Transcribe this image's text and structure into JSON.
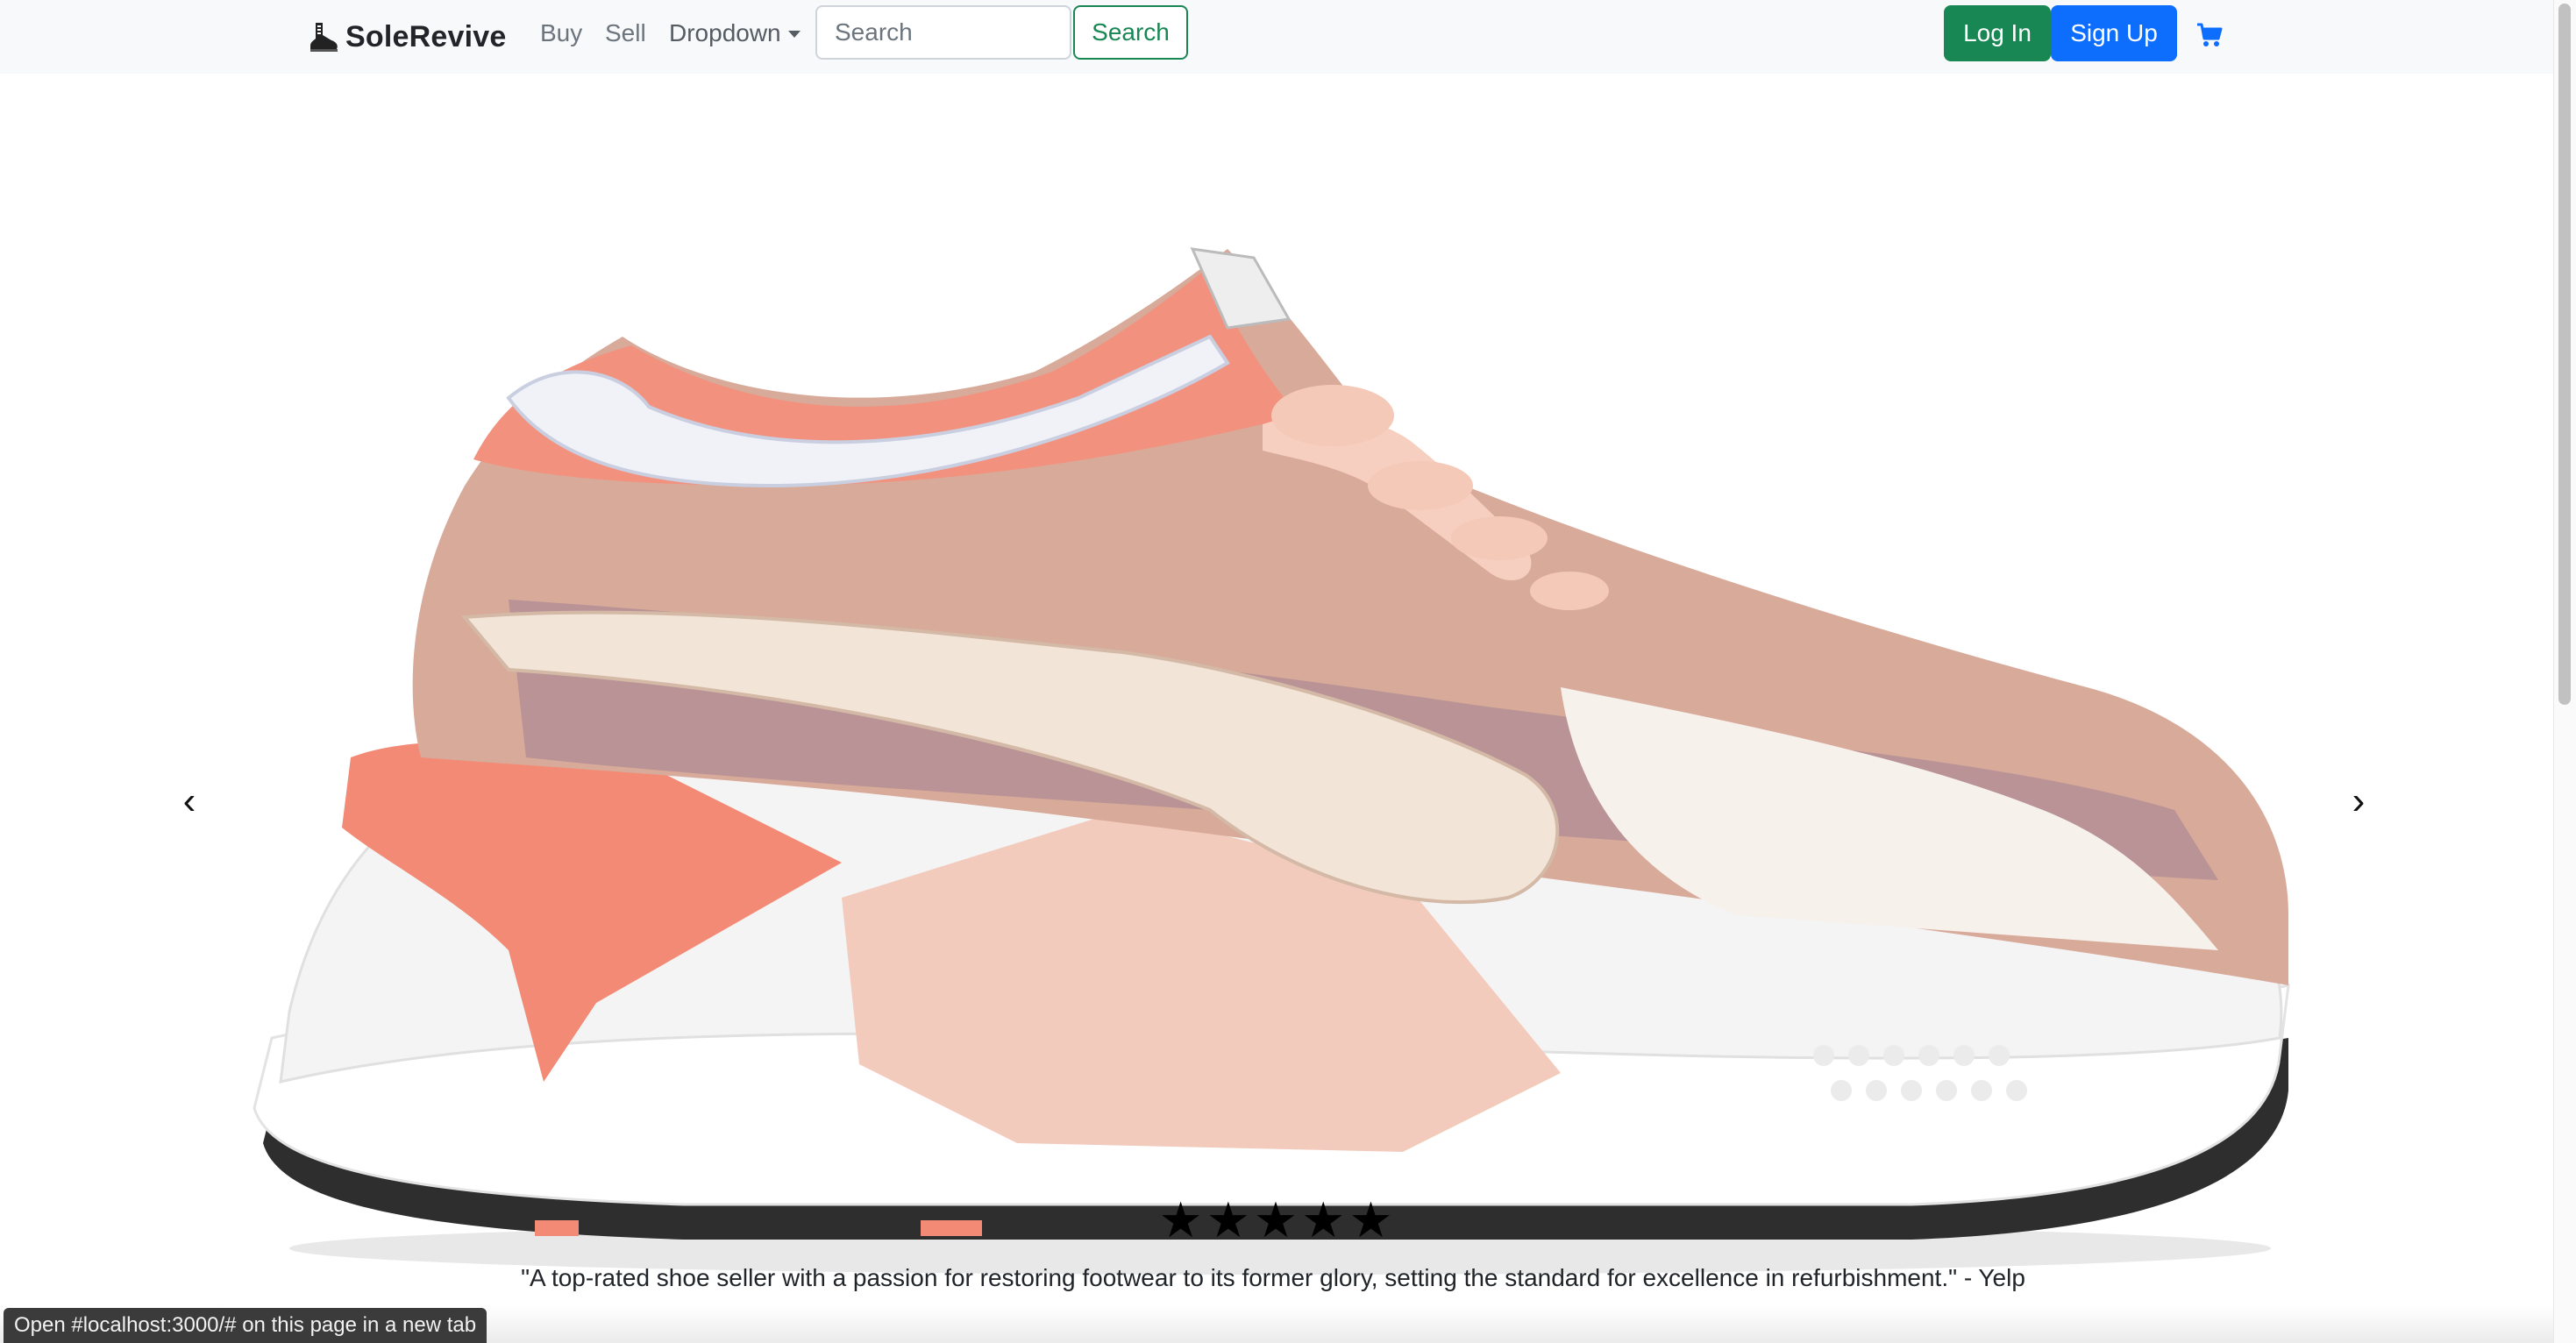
{
  "navbar": {
    "brand": "SoleRevive",
    "links": {
      "buy": "Buy",
      "sell": "Sell",
      "dropdown": "Dropdown"
    },
    "search": {
      "placeholder": "Search",
      "button": "Search"
    },
    "login": "Log In",
    "signup": "Sign Up",
    "cart_icon": "shopping-cart-icon"
  },
  "carousel": {
    "prev_glyph": "‹",
    "next_glyph": "›",
    "slide_alt": "Pink and white PUMA RS-X sneaker",
    "rating_stars": 5,
    "stars": [
      "★",
      "★",
      "★",
      "★",
      "★"
    ],
    "testimonial": "\"A top-rated shoe seller with a passion for restoring footwear to its former glory, setting the standard for excellence in refurbishment.\" - Yelp"
  },
  "status_bar": "Open #localhost:3000/# on this page in a new tab",
  "colors": {
    "success": "#198754",
    "primary": "#0d6efd",
    "navbar_bg": "#f8f9fa"
  }
}
